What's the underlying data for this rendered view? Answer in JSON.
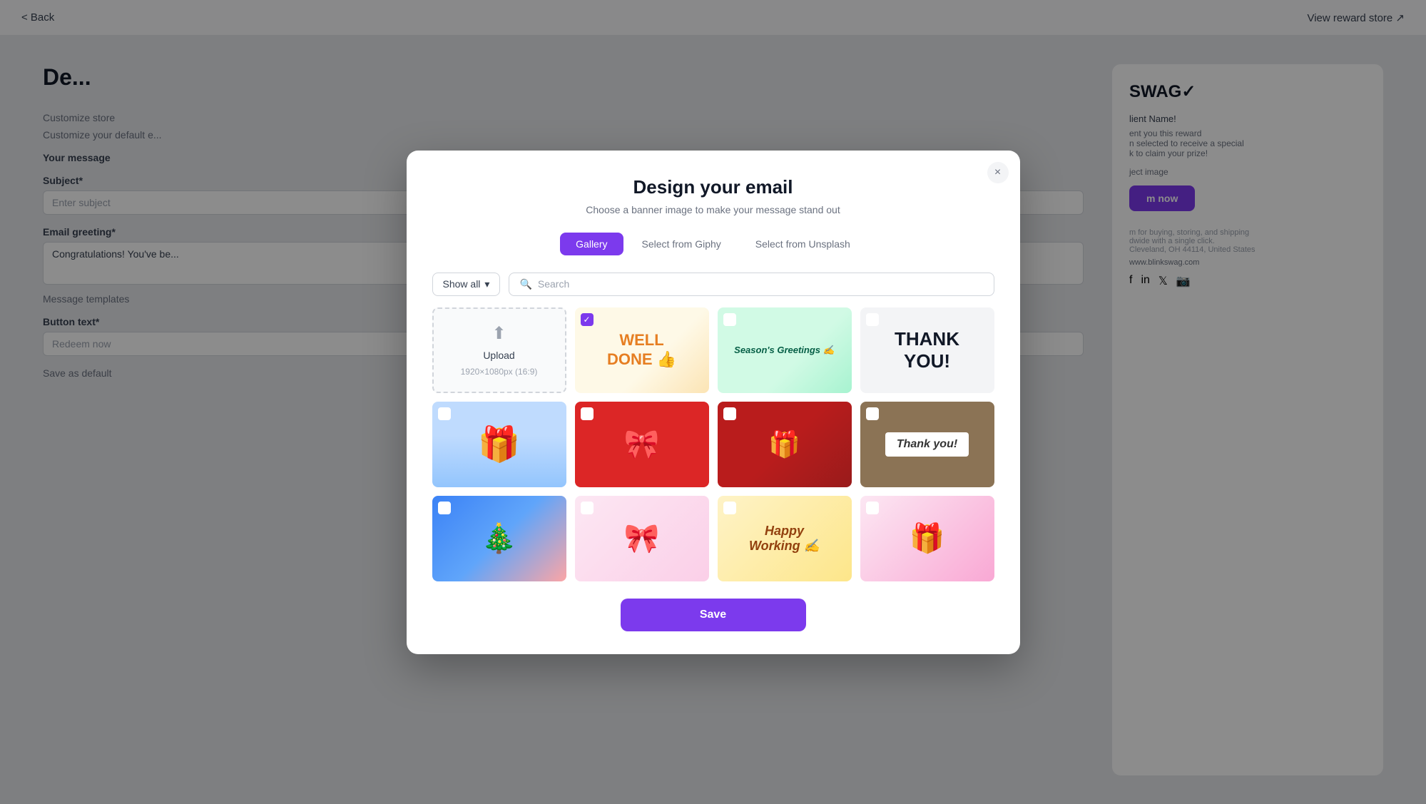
{
  "page": {
    "back_label": "< Back",
    "view_reward_label": "View reward store ↗"
  },
  "background": {
    "title": "De...",
    "customize_store": "Customize store",
    "customize_default_email": "Customize your default e...",
    "your_message": "Your message",
    "subject_label": "Subject*",
    "subject_placeholder": "Enter subject",
    "email_greeting_label": "Email greeting*",
    "email_greeting_value": "Congratulations! You've be...",
    "message_templates": "Message templates",
    "button_text_label": "Button text*",
    "button_text_value": "Redeem now",
    "save_as_default": "Save as default"
  },
  "modal": {
    "title": "Design your email",
    "subtitle": "Choose a banner image to make your message stand out",
    "close_label": "×",
    "tabs": [
      {
        "id": "gallery",
        "label": "Gallery",
        "active": true
      },
      {
        "id": "giphy",
        "label": "Select from Giphy",
        "active": false
      },
      {
        "id": "unsplash",
        "label": "Select from Unsplash",
        "active": false
      }
    ],
    "filter": {
      "dropdown_label": "Show all",
      "search_placeholder": "Search"
    },
    "upload": {
      "icon": "⬆",
      "label": "Upload",
      "dimensions": "1920×1080px (16:9)"
    },
    "gallery_images": [
      {
        "id": "well-done",
        "alt": "Well Done",
        "checked": true,
        "color_class": "img-well-done",
        "text": "WELL DONE 👍",
        "text_color": "#e67e22"
      },
      {
        "id": "seasons",
        "alt": "Seasons Greetings",
        "checked": false,
        "color_class": "img-seasons",
        "text": "Season's Greetings ✍",
        "text_color": "#065f46"
      },
      {
        "id": "thank-you",
        "alt": "Thank You",
        "checked": false,
        "color_class": "img-thankyou",
        "text": "THANK YOU!",
        "text_color": "#111827"
      },
      {
        "id": "blue-box",
        "alt": "Blue Gift Box",
        "checked": false,
        "color_class": "img-blue-box",
        "text": "🎁",
        "text_color": "#1d4ed8"
      },
      {
        "id": "red-wrap",
        "alt": "Red Wrapping",
        "checked": false,
        "color_class": "img-red-wrap",
        "text": "",
        "text_color": "#fff"
      },
      {
        "id": "red-gift",
        "alt": "Red Gift",
        "checked": false,
        "color_class": "img-red-gift",
        "text": "",
        "text_color": "#fff"
      },
      {
        "id": "thank-you2",
        "alt": "Thank You Card",
        "checked": false,
        "color_class": "img-thankyou2",
        "text": "Thank you!",
        "text_color": "#fff"
      },
      {
        "id": "blue-ball",
        "alt": "Blue Ball Gift",
        "checked": false,
        "color_class": "img-blue-ball",
        "text": "🎄",
        "text_color": "#fff"
      },
      {
        "id": "pink-wrap",
        "alt": "Pink Wrapping",
        "checked": false,
        "color_class": "img-pink-wrap",
        "text": "🎀",
        "text_color": "#ec4899"
      },
      {
        "id": "happy-work",
        "alt": "Happy Working",
        "checked": false,
        "color_class": "img-happy-work",
        "text": "Happy Working ✍",
        "text_color": "#92400e"
      },
      {
        "id": "pink-gift",
        "alt": "Pink Gift",
        "checked": false,
        "color_class": "img-pink-gift",
        "text": "🎁",
        "text_color": "#db2777"
      }
    ],
    "save_button_label": "Save"
  },
  "right_panel": {
    "logo": "SWAG✓",
    "recipient_name_label": "lient Name!",
    "sent_reward_text": "ent you this reward",
    "selected_text": "n selected to receive a special",
    "claim_text": "k to claim your prize!",
    "select_image_label": "ject image",
    "redeem_btn": "m now",
    "platform_text": "m for buying, storing, and shipping",
    "worldwide_text": "dwide with a single click.",
    "address": "Cleveland, OH 44114, United States",
    "website": "www.blinkswag.com"
  }
}
